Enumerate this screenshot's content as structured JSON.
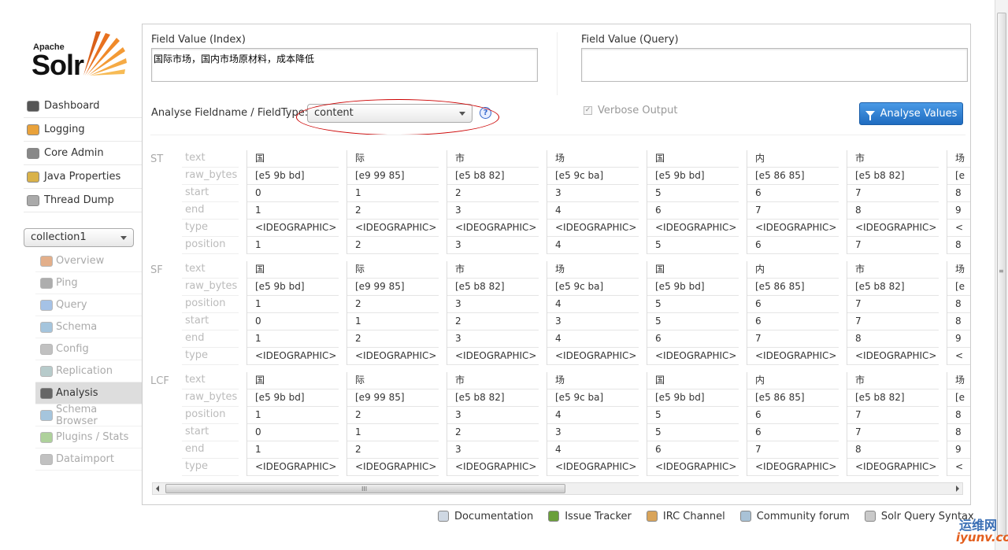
{
  "logo": {
    "apache": "Apache",
    "solr": "Solr"
  },
  "nav": [
    {
      "label": "Dashboard",
      "icon": "dashboard-icon"
    },
    {
      "label": "Logging",
      "icon": "logging-icon"
    },
    {
      "label": "Core Admin",
      "icon": "core-admin-icon"
    },
    {
      "label": "Java Properties",
      "icon": "java-properties-icon"
    },
    {
      "label": "Thread Dump",
      "icon": "thread-dump-icon"
    }
  ],
  "core_selector": {
    "value": "collection1"
  },
  "core_menu": [
    {
      "label": "Overview",
      "icon": "overview-icon"
    },
    {
      "label": "Ping",
      "icon": "ping-icon"
    },
    {
      "label": "Query",
      "icon": "query-icon"
    },
    {
      "label": "Schema",
      "icon": "schema-icon"
    },
    {
      "label": "Config",
      "icon": "config-icon"
    },
    {
      "label": "Replication",
      "icon": "replication-icon"
    },
    {
      "label": "Analysis",
      "icon": "analysis-icon",
      "active": true
    },
    {
      "label": "Schema Browser",
      "icon": "schema-browser-icon"
    },
    {
      "label": "Plugins / Stats",
      "icon": "plugins-icon"
    },
    {
      "label": "Dataimport",
      "icon": "dataimport-icon"
    }
  ],
  "analysis": {
    "index_label": "Field Value (Index)",
    "index_value": "国际市场，国内市场原材料，成本降低",
    "query_label": "Field Value (Query)",
    "query_value": "",
    "fieldtype_label": "Analyse Fieldname / FieldType:",
    "fieldtype_value": "content",
    "help": "?",
    "verbose_label": "Verbose Output",
    "verbose_checked": true,
    "analyse_button": "Analyse Values"
  },
  "stages": [
    {
      "name": "ST",
      "keys": [
        "text",
        "raw_bytes",
        "start",
        "end",
        "type",
        "position"
      ],
      "tokens": [
        [
          "国",
          "[e5 9b bd]",
          "0",
          "1",
          "<IDEOGRAPHIC>",
          "1"
        ],
        [
          "际",
          "[e9 99 85]",
          "1",
          "2",
          "<IDEOGRAPHIC>",
          "2"
        ],
        [
          "市",
          "[e5 b8 82]",
          "2",
          "3",
          "<IDEOGRAPHIC>",
          "3"
        ],
        [
          "场",
          "[e5 9c ba]",
          "3",
          "4",
          "<IDEOGRAPHIC>",
          "4"
        ],
        [
          "国",
          "[e5 9b bd]",
          "5",
          "6",
          "<IDEOGRAPHIC>",
          "5"
        ],
        [
          "内",
          "[e5 86 85]",
          "6",
          "7",
          "<IDEOGRAPHIC>",
          "6"
        ],
        [
          "市",
          "[e5 b8 82]",
          "7",
          "8",
          "<IDEOGRAPHIC>",
          "7"
        ],
        [
          "场",
          "[e",
          "8",
          "9",
          "<",
          "8"
        ]
      ]
    },
    {
      "name": "SF",
      "keys": [
        "text",
        "raw_bytes",
        "position",
        "start",
        "end",
        "type"
      ],
      "tokens": [
        [
          "国",
          "[e5 9b bd]",
          "1",
          "0",
          "1",
          "<IDEOGRAPHIC>"
        ],
        [
          "际",
          "[e9 99 85]",
          "2",
          "1",
          "2",
          "<IDEOGRAPHIC>"
        ],
        [
          "市",
          "[e5 b8 82]",
          "3",
          "2",
          "3",
          "<IDEOGRAPHIC>"
        ],
        [
          "场",
          "[e5 9c ba]",
          "4",
          "3",
          "4",
          "<IDEOGRAPHIC>"
        ],
        [
          "国",
          "[e5 9b bd]",
          "5",
          "5",
          "6",
          "<IDEOGRAPHIC>"
        ],
        [
          "内",
          "[e5 86 85]",
          "6",
          "6",
          "7",
          "<IDEOGRAPHIC>"
        ],
        [
          "市",
          "[e5 b8 82]",
          "7",
          "7",
          "8",
          "<IDEOGRAPHIC>"
        ],
        [
          "场",
          "[e",
          "8",
          "8",
          "9",
          "<"
        ]
      ]
    },
    {
      "name": "LCF",
      "keys": [
        "text",
        "raw_bytes",
        "position",
        "start",
        "end",
        "type"
      ],
      "tokens": [
        [
          "国",
          "[e5 9b bd]",
          "1",
          "0",
          "1",
          "<IDEOGRAPHIC>"
        ],
        [
          "际",
          "[e9 99 85]",
          "2",
          "1",
          "2",
          "<IDEOGRAPHIC>"
        ],
        [
          "市",
          "[e5 b8 82]",
          "3",
          "2",
          "3",
          "<IDEOGRAPHIC>"
        ],
        [
          "场",
          "[e5 9c ba]",
          "4",
          "3",
          "4",
          "<IDEOGRAPHIC>"
        ],
        [
          "国",
          "[e5 9b bd]",
          "5",
          "5",
          "6",
          "<IDEOGRAPHIC>"
        ],
        [
          "内",
          "[e5 86 85]",
          "6",
          "6",
          "7",
          "<IDEOGRAPHIC>"
        ],
        [
          "市",
          "[e5 b8 82]",
          "7",
          "7",
          "8",
          "<IDEOGRAPHIC>"
        ],
        [
          "场",
          "[e",
          "8",
          "8",
          "9",
          "<"
        ]
      ]
    }
  ],
  "scrollbar": {
    "grip": "III"
  },
  "footer": [
    {
      "label": "Documentation",
      "icon": "documentation-icon"
    },
    {
      "label": "Issue Tracker",
      "icon": "bug-icon"
    },
    {
      "label": "IRC Channel",
      "icon": "irc-icon"
    },
    {
      "label": "Community forum",
      "icon": "mail-icon"
    },
    {
      "label": "Solr Query Syntax",
      "icon": "query-syntax-icon"
    }
  ],
  "watermark": {
    "line1": "运维网",
    "line2": "iyunv.com"
  },
  "colors": {
    "accent": "#1f6cc0",
    "annotation": "#cc0000",
    "active_bg": "#dddddd"
  }
}
